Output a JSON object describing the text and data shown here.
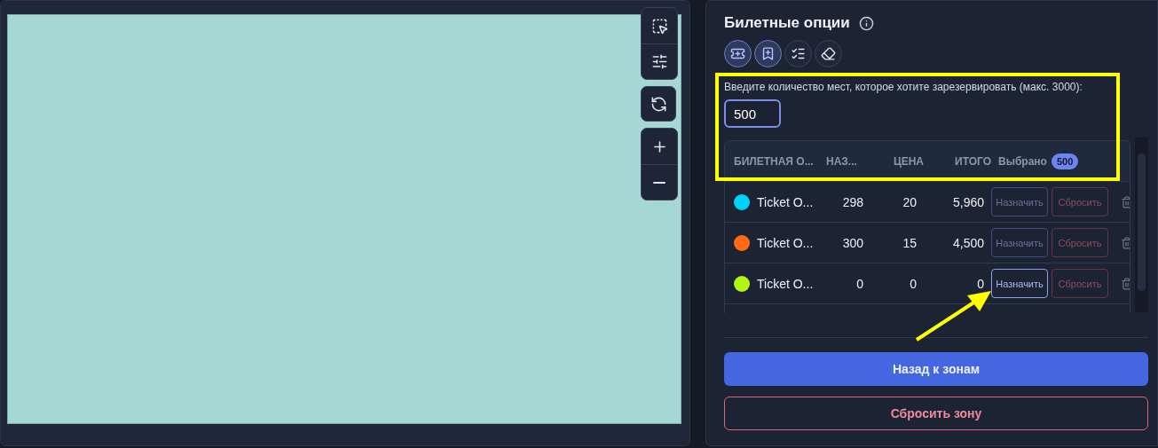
{
  "tools": [
    {
      "selected": true
    },
    {
      "selected": true
    },
    {
      "selected": false
    },
    {
      "selected": false
    }
  ],
  "panel": {
    "title": "Билетные опции",
    "quantity_label": "Введите количество мест, которое хотите зарезервировать (макс. 3000):",
    "quantity_value": "500"
  },
  "table": {
    "columns": [
      "БИЛЕТНАЯ О...",
      "НАЗ...",
      "ЦЕНА",
      "ИТОГО",
      "Выбрано"
    ],
    "selected_count": "500",
    "rows": [
      {
        "color": "#00d2f5",
        "name": "Ticket O...",
        "assigned": "298",
        "price": "20",
        "total": "5,960",
        "assign": "Назначить",
        "reset": "Сбросить",
        "highlighted": false
      },
      {
        "color": "#ff6a14",
        "name": "Ticket O...",
        "assigned": "300",
        "price": "15",
        "total": "4,500",
        "assign": "Назначить",
        "reset": "Сбросить",
        "highlighted": false
      },
      {
        "color": "#b2f514",
        "name": "Ticket O...",
        "assigned": "0",
        "price": "0",
        "total": "0",
        "assign": "Назначить",
        "reset": "Сбросить",
        "highlighted": true
      }
    ]
  },
  "buttons": {
    "back": "Назад к зонам",
    "reset_zone": "Сбросить зону"
  }
}
